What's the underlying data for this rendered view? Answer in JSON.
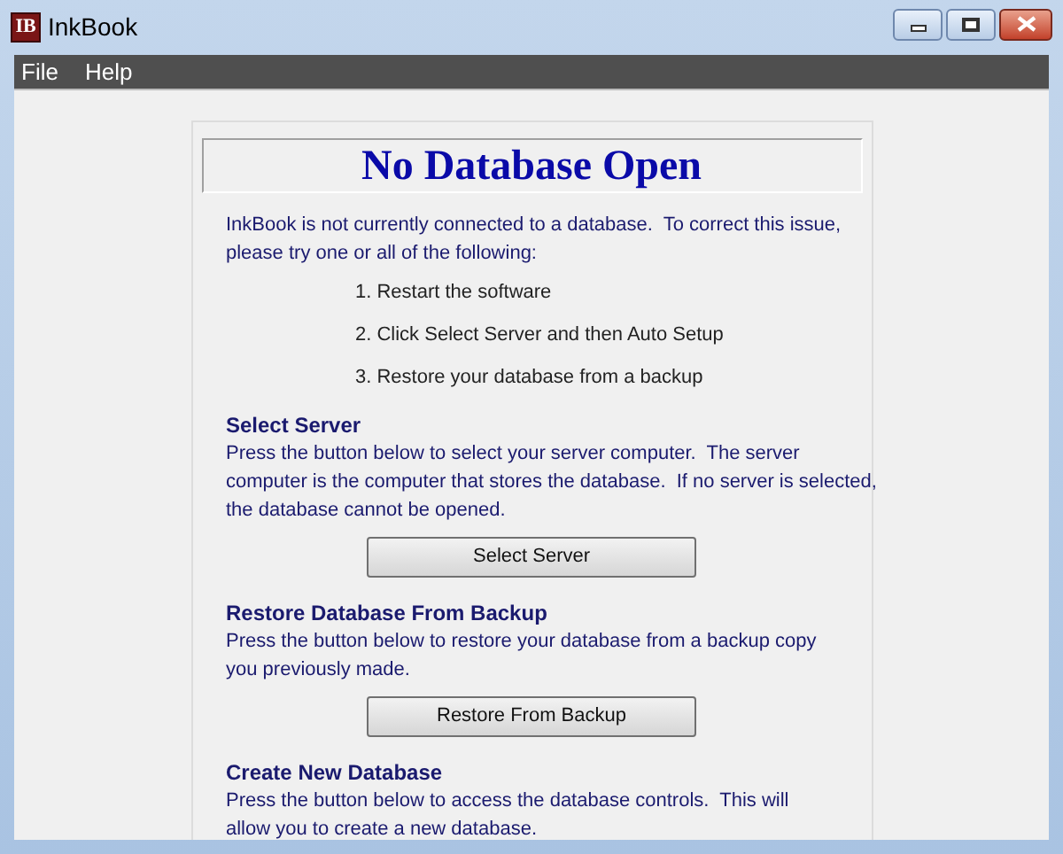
{
  "window": {
    "title": "InkBook",
    "app_icon": "IB"
  },
  "menu": [
    "File",
    "Help"
  ],
  "heading": "No Database Open",
  "intro": "InkBook is not currently connected to a database.  To correct this issue,\nplease try one or all of the following:",
  "steps": [
    "1. Restart the software",
    "2. Click Select Server and then Auto Setup",
    "3. Restore your database from a backup"
  ],
  "sections": [
    {
      "title": "Select Server",
      "body": "Press the button below to select your server computer.  The server\ncomputer is the computer that stores the database.  If no server is selected,\nthe database cannot be opened.",
      "button": "Select Server"
    },
    {
      "title": "Restore Database From Backup",
      "body": "Press the button below to restore your database from a backup copy\nyou previously made.",
      "button": "Restore From Backup"
    },
    {
      "title": "Create New Database",
      "body": "Press the button below to access the database controls.  This will\nallow you to create a new database."
    }
  ]
}
